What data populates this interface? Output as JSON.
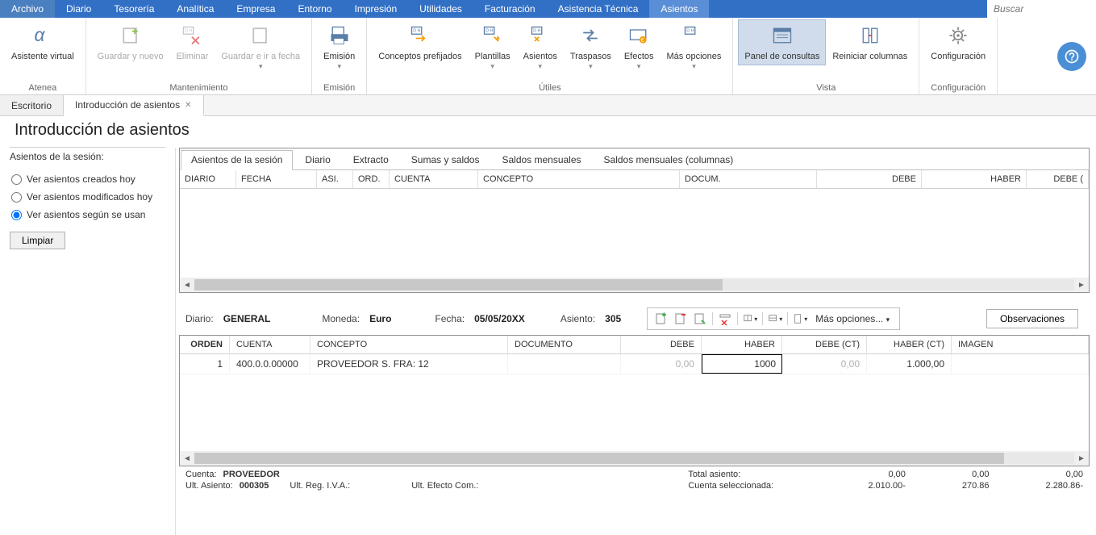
{
  "menu": [
    "Archivo",
    "Diario",
    "Tesorería",
    "Analítica",
    "Empresa",
    "Entorno",
    "Impresión",
    "Utilidades",
    "Facturación",
    "Asistencia Técnica",
    "Asientos"
  ],
  "menu_active_index": 10,
  "search_placeholder": "Buscar",
  "ribbon": {
    "atenea": {
      "label": "Atenea",
      "btn": "Asistente virtual"
    },
    "manten": {
      "label": "Mantenimiento",
      "btns": [
        "Guardar y nuevo",
        "Eliminar",
        "Guardar e ir a fecha"
      ]
    },
    "emision": {
      "label": "Emisión",
      "btn": "Emisión"
    },
    "utiles": {
      "label": "Útiles",
      "btns": [
        "Conceptos prefijados",
        "Plantillas",
        "Asientos",
        "Traspasos",
        "Efectos",
        "Más opciones"
      ]
    },
    "vista": {
      "label": "Vista",
      "btns": [
        "Panel de consultas",
        "Reiniciar columnas"
      ]
    },
    "config": {
      "label": "Configuración",
      "btn": "Configuración"
    }
  },
  "doc_tabs": [
    "Escritorio",
    "Introducción de asientos"
  ],
  "doc_tab_active": 1,
  "page_title": "Introducción de asientos",
  "left": {
    "title": "Asientos de la sesión:",
    "radios": [
      "Ver asientos creados hoy",
      "Ver asientos modificados hoy",
      "Ver asientos según se usan"
    ],
    "selected": 2,
    "limpiar": "Limpiar"
  },
  "inner_tabs": [
    "Asientos de la sesión",
    "Diario",
    "Extracto",
    "Sumas y saldos",
    "Saldos mensuales",
    "Saldos mensuales (columnas)"
  ],
  "inner_tab_active": 0,
  "grid1_cols": [
    "DIARIO",
    "FECHA",
    "ASI.",
    "ORD.",
    "CUENTA",
    "CONCEPTO",
    "DOCUM.",
    "DEBE",
    "HABER",
    "DEBE ("
  ],
  "entry_header": {
    "diario_lbl": "Diario:",
    "diario_val": "GENERAL",
    "moneda_lbl": "Moneda:",
    "moneda_val": "Euro",
    "fecha_lbl": "Fecha:",
    "fecha_val": "05/05/20XX",
    "asiento_lbl": "Asiento:",
    "asiento_val": "305",
    "more": "Más opciones...",
    "obs": "Observaciones"
  },
  "entry_cols": [
    "ORDEN",
    "CUENTA",
    "CONCEPTO",
    "DOCUMENTO",
    "DEBE",
    "HABER",
    "DEBE (CT)",
    "HABER (CT)",
    "IMAGEN"
  ],
  "entry_rows": [
    {
      "orden": "1",
      "cuenta": "400.0.0.00000",
      "concepto": "PROVEEDOR S. FRA:  12",
      "documento": "",
      "debe": "0,00",
      "haber": "1000",
      "debe_ct": "0,00",
      "haber_ct": "1.000,00",
      "imagen": ""
    }
  ],
  "footer": {
    "cuenta_lbl": "Cuenta:",
    "cuenta_val": "PROVEEDOR",
    "ult_asiento_lbl": "Ult. Asiento:",
    "ult_asiento_val": "000305",
    "ult_reg_iva": "Ult. Reg. I.V.A.:",
    "ult_efecto": "Ult. Efecto Com.:",
    "total_asiento_lbl": "Total asiento:",
    "cuenta_sel_lbl": "Cuenta seleccionada:",
    "totals_row1": [
      "0,00",
      "0,00",
      "0,00"
    ],
    "totals_row2": [
      "2.010.00-",
      "270.86",
      "2.280.86-"
    ]
  }
}
